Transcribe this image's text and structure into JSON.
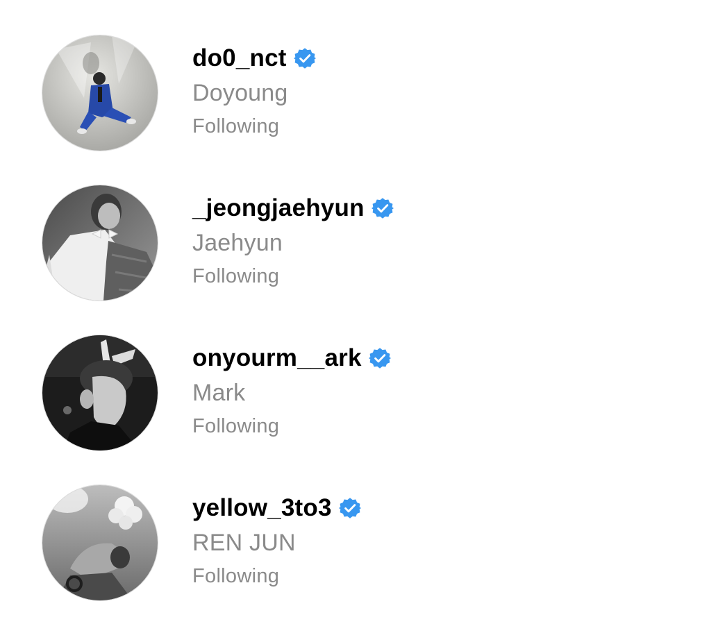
{
  "accounts": [
    {
      "username": "do0_nct",
      "name": "Doyoung",
      "status": "Following",
      "verified": true,
      "avatar": "person-seated-blue-suit-photo"
    },
    {
      "username": "_jeongjaehyun",
      "name": "Jaehyun",
      "status": "Following",
      "verified": true,
      "avatar": "person-black-white-portrait-photo"
    },
    {
      "username": "onyourm__ark",
      "name": "Mark",
      "status": "Following",
      "verified": true,
      "avatar": "person-profile-bunny-ears-photo"
    },
    {
      "username": "yellow_3to3",
      "name": "REN JUN",
      "status": "Following",
      "verified": true,
      "avatar": "person-looking-up-smoke-photo"
    }
  ],
  "colors": {
    "verified_badge": "#3897f0",
    "secondary_text": "#8a8a8a",
    "primary_text": "#000000"
  }
}
